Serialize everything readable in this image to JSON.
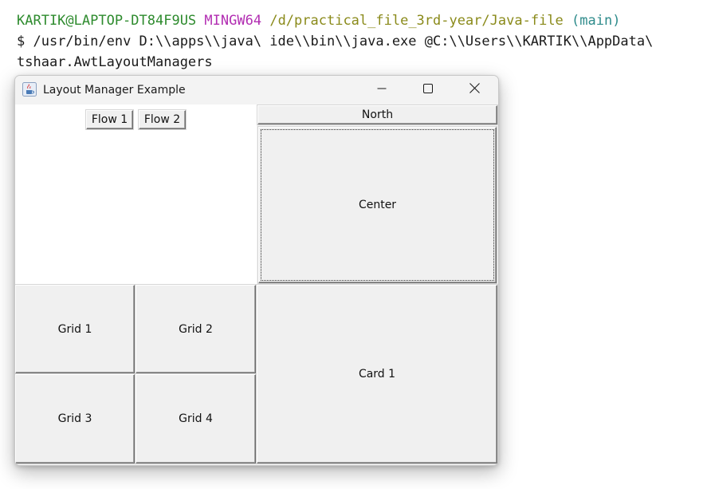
{
  "terminal": {
    "prompt": {
      "user_host": "KARTIK@LAPTOP-DT84F9US",
      "system": "MINGW64",
      "path": "/d/practical_file_3rd-year/Java-file",
      "branch": "(main)"
    },
    "command_prefix": "$",
    "command": " /usr/bin/env D:\\\\apps\\\\java\\ ide\\\\bin\\\\java.exe @C:\\\\Users\\\\KARTIK\\\\AppData\\",
    "command_continuation": "tshaar.AwtLayoutManagers"
  },
  "window": {
    "title": "Layout Manager Example",
    "icon": "java-cup-icon",
    "controls": {
      "minimize": "minimize-icon",
      "maximize": "maximize-icon",
      "close": "close-icon"
    }
  },
  "flow_panel": {
    "buttons": [
      "Flow 1",
      "Flow 2"
    ]
  },
  "border_panel": {
    "north": "North",
    "center": "Center"
  },
  "grid_panel": {
    "buttons": [
      "Grid 1",
      "Grid 2",
      "Grid 3",
      "Grid 4"
    ]
  },
  "card_panel": {
    "current": "Card 1"
  },
  "colors": {
    "terminal_user": "#2e8b2e",
    "terminal_system": "#b22eb2",
    "terminal_path": "#8a8a1a",
    "terminal_branch": "#2e8b8b",
    "awt_background": "#f0f0f0"
  }
}
